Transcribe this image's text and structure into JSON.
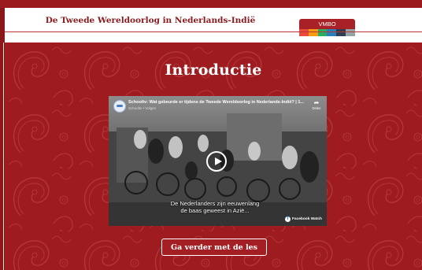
{
  "header": {
    "title": "De Tweede Wereldoorlog in Nederlands-Indië",
    "level_label": "VMBO",
    "stripe_colors": [
      "#e94b3c",
      "#f39c12",
      "#27ae60",
      "#2980b9",
      "#2c3e50",
      "#95a5a6"
    ]
  },
  "hero": {
    "title": "Introductie"
  },
  "video": {
    "title": "Schooltv: Wat gebeurde er tijdens de Tweede Wereldoorlog in Nederlands-Indië? | 1...",
    "channel": "Schooltv • Volgen",
    "share_label": "Delen",
    "subtitle_line1": "De Nederlanders zijn eeuwenlang",
    "subtitle_line2": "de baas geweest in Azië...",
    "platform_label": "Facebook Watch"
  },
  "cta": {
    "label": "Ga verder met de les"
  },
  "colors": {
    "brand_red": "#9b1a1e",
    "button_red": "#a41f24"
  }
}
